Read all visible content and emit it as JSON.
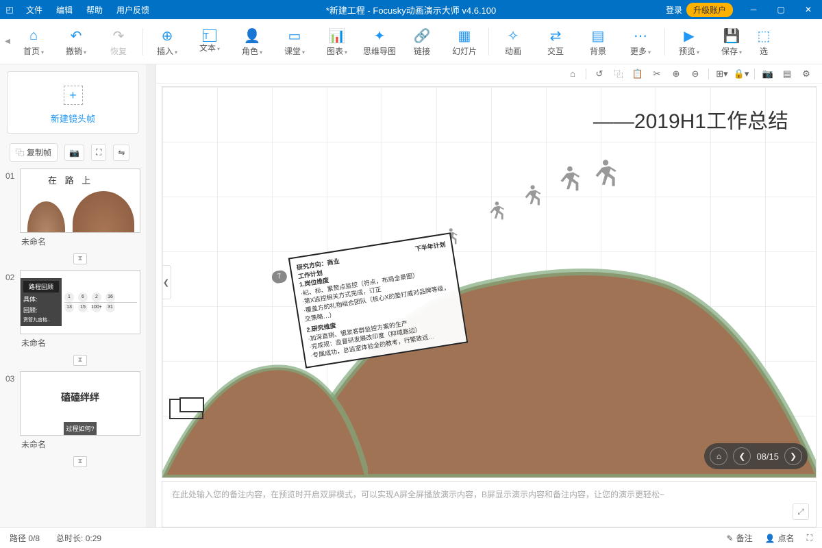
{
  "titlebar": {
    "menus": [
      "文件",
      "编辑",
      "帮助",
      "用户反馈"
    ],
    "title": "*新建工程 - Focusky动画演示大师  v4.6.100",
    "login": "登录",
    "upgrade": "升级账户"
  },
  "ribbon": {
    "buttons": [
      {
        "icon": "⌂",
        "label": "首页",
        "dd": true
      },
      {
        "icon": "↶",
        "label": "撤销",
        "dd": true
      },
      {
        "icon": "↷",
        "label": "恢复",
        "disabled": true
      }
    ],
    "buttons2": [
      {
        "icon": "⊕",
        "label": "插入",
        "dd": true
      },
      {
        "icon": "T",
        "label": "文本",
        "dd": true
      },
      {
        "icon": "☺",
        "label": "角色",
        "dd": true
      },
      {
        "icon": "▭",
        "label": "课堂",
        "dd": true
      },
      {
        "icon": "◫",
        "label": "图表",
        "dd": true
      },
      {
        "icon": "✦",
        "label": "思维导图"
      },
      {
        "icon": "🔗",
        "label": "链接"
      },
      {
        "icon": "▦",
        "label": "幻灯片"
      }
    ],
    "buttons3": [
      {
        "icon": "✧",
        "label": "动画"
      },
      {
        "icon": "⇄",
        "label": "交互"
      },
      {
        "icon": "▤",
        "label": "背景"
      },
      {
        "icon": "⋯",
        "label": "更多",
        "dd": true
      }
    ],
    "buttons4": [
      {
        "icon": "▶",
        "label": "预览",
        "dd": true
      },
      {
        "icon": "💾",
        "label": "保存",
        "dd": true
      },
      {
        "icon": "⬚",
        "label": "选"
      }
    ]
  },
  "sidebar": {
    "newframe": "新建镜头帧",
    "copyframe": "复制帧",
    "slides": [
      {
        "num": "01",
        "name": "未命名",
        "thumb_type": "hill",
        "title": "在  路  上"
      },
      {
        "num": "02",
        "name": "未命名",
        "thumb_type": "data",
        "title": "路程回顾",
        "sub": [
          "具体:",
          "回顾:"
        ],
        "nums": [
          "1",
          "6",
          "2",
          "16"
        ],
        "bottom": "资管九宫格..",
        "b2": [
          "13",
          "15",
          "100+",
          "31"
        ]
      },
      {
        "num": "03",
        "name": "未命名",
        "thumb_type": "text",
        "title": "磕磕绊绊",
        "footer": "过程如何?"
      }
    ]
  },
  "canvas": {
    "title": "——2019H1工作总结",
    "card": {
      "num": "7",
      "heading": "下半年计划",
      "line1": "研究方向：商业",
      "line2": "工作计划",
      "line3": "1.岗位维度",
      "line4": "·纪、标、累赘点监控（符点，布局全景图）",
      "line5": "·第X监控相关方式完成，订正",
      "line6": "·覆盖方的礼物组合团队（核心X的垫打威对品牌等级，交策略…）",
      "line7": "2.研究维度",
      "line8": "·加深直销、银发客群监控方案的生产",
      "line9": "·完成规：监督研发展改印度（抑域路边）",
      "line10": "·专属成功，总监室体验全的教考，行繁致远…"
    },
    "nav": {
      "count": "08/15"
    }
  },
  "notes": {
    "placeholder": "在此处输入您的备注内容，在预览时开启双屏模式，可以实现A屏全屏播放演示内容，B屏显示演示内容和备注内容，让您的演示更轻松~"
  },
  "statusbar": {
    "path": "路径 0/8",
    "duration": "总时长: 0:29",
    "notes_btn": "备注",
    "roll_btn": "点名"
  }
}
